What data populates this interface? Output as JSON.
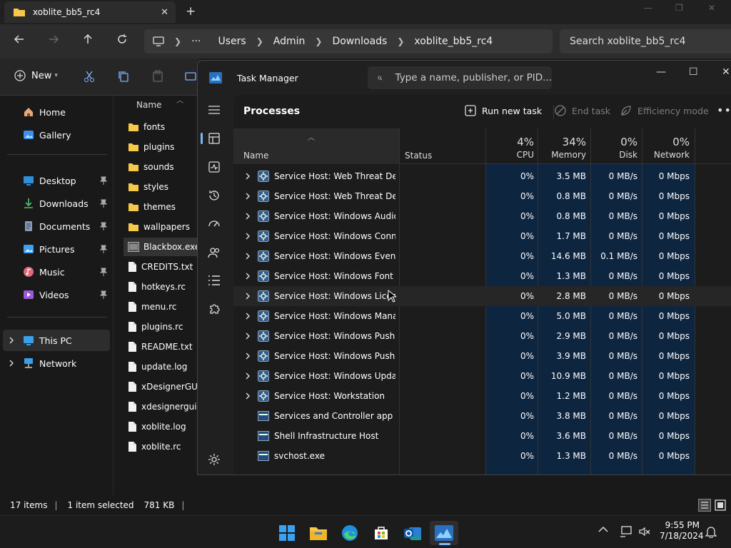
{
  "explorer": {
    "tab_title": "xoblite_bb5_rc4",
    "breadcrumb": [
      "Users",
      "Admin",
      "Downloads",
      "xoblite_bb5_rc4"
    ],
    "search_placeholder": "Search xoblite_bb5_rc4",
    "new_label": "New",
    "list_header": "Name",
    "nav_items": [
      {
        "label": "Home"
      },
      {
        "label": "Gallery"
      },
      {
        "label": "Desktop"
      },
      {
        "label": "Downloads"
      },
      {
        "label": "Documents"
      },
      {
        "label": "Pictures"
      },
      {
        "label": "Music"
      },
      {
        "label": "Videos"
      },
      {
        "label": "This PC"
      },
      {
        "label": "Network"
      }
    ],
    "files": [
      {
        "name": "fonts",
        "type": "folder"
      },
      {
        "name": "plugins",
        "type": "folder"
      },
      {
        "name": "sounds",
        "type": "folder"
      },
      {
        "name": "styles",
        "type": "folder"
      },
      {
        "name": "themes",
        "type": "folder"
      },
      {
        "name": "wallpapers",
        "type": "folder"
      },
      {
        "name": "Blackbox.exe",
        "type": "exe"
      },
      {
        "name": "CREDITS.txt",
        "type": "file"
      },
      {
        "name": "hotkeys.rc",
        "type": "file"
      },
      {
        "name": "menu.rc",
        "type": "file"
      },
      {
        "name": "plugins.rc",
        "type": "file"
      },
      {
        "name": "README.txt",
        "type": "file"
      },
      {
        "name": "update.log",
        "type": "file"
      },
      {
        "name": "xDesignerGUI.c",
        "type": "file"
      },
      {
        "name": "xdesignergui.rc",
        "type": "file"
      },
      {
        "name": "xoblite.log",
        "type": "file"
      },
      {
        "name": "xoblite.rc",
        "type": "file"
      }
    ],
    "status": {
      "items": "17 items",
      "selected": "1 item selected",
      "size": "781 KB"
    }
  },
  "taskmgr": {
    "title": "Task Manager",
    "search_placeholder": "Type a name, publisher, or PID...",
    "section_title": "Processes",
    "actions": {
      "run_new_task": "Run new task",
      "end_task": "End task",
      "efficiency_mode": "Efficiency mode"
    },
    "columns": {
      "name": "Name",
      "status": "Status",
      "cpu_pct": "4%",
      "cpu": "CPU",
      "mem_pct": "34%",
      "mem": "Memory",
      "disk_pct": "0%",
      "disk": "Disk",
      "net_pct": "0%",
      "net": "Network"
    },
    "processes": [
      {
        "name": "Service Host: Web Threat Defe...",
        "cpu": "0%",
        "mem": "3.5 MB",
        "disk": "0 MB/s",
        "net": "0 Mbps",
        "expand": true
      },
      {
        "name": "Service Host: Web Threat Defe...",
        "cpu": "0%",
        "mem": "0.8 MB",
        "disk": "0 MB/s",
        "net": "0 Mbps",
        "expand": true
      },
      {
        "name": "Service Host: Windows Audio ...",
        "cpu": "0%",
        "mem": "0.8 MB",
        "disk": "0 MB/s",
        "net": "0 Mbps",
        "expand": true
      },
      {
        "name": "Service Host: Windows Conne...",
        "cpu": "0%",
        "mem": "1.7 MB",
        "disk": "0 MB/s",
        "net": "0 Mbps",
        "expand": true
      },
      {
        "name": "Service Host: Windows Event ...",
        "cpu": "0%",
        "mem": "14.6 MB",
        "disk": "0.1 MB/s",
        "net": "0 Mbps",
        "expand": true
      },
      {
        "name": "Service Host: Windows Font C...",
        "cpu": "0%",
        "mem": "1.3 MB",
        "disk": "0 MB/s",
        "net": "0 Mbps",
        "expand": true
      },
      {
        "name": "Service Host: Windows License...",
        "cpu": "0%",
        "mem": "2.8 MB",
        "disk": "0 MB/s",
        "net": "0 Mbps",
        "expand": true
      },
      {
        "name": "Service Host: Windows Manag...",
        "cpu": "0%",
        "mem": "5.0 MB",
        "disk": "0 MB/s",
        "net": "0 Mbps",
        "expand": true
      },
      {
        "name": "Service Host: Windows Push ...",
        "cpu": "0%",
        "mem": "2.9 MB",
        "disk": "0 MB/s",
        "net": "0 Mbps",
        "expand": true
      },
      {
        "name": "Service Host: Windows Push ...",
        "cpu": "0%",
        "mem": "3.9 MB",
        "disk": "0 MB/s",
        "net": "0 Mbps",
        "expand": true
      },
      {
        "name": "Service Host: Windows Update",
        "cpu": "0%",
        "mem": "10.9 MB",
        "disk": "0 MB/s",
        "net": "0 Mbps",
        "expand": true
      },
      {
        "name": "Service Host: Workstation",
        "cpu": "0%",
        "mem": "1.2 MB",
        "disk": "0 MB/s",
        "net": "0 Mbps",
        "expand": true
      },
      {
        "name": "Services and Controller app",
        "cpu": "0%",
        "mem": "3.8 MB",
        "disk": "0 MB/s",
        "net": "0 Mbps",
        "expand": false
      },
      {
        "name": "Shell Infrastructure Host",
        "cpu": "0%",
        "mem": "3.6 MB",
        "disk": "0 MB/s",
        "net": "0 Mbps",
        "expand": false
      },
      {
        "name": "svchost.exe",
        "cpu": "0%",
        "mem": "1.3 MB",
        "disk": "0 MB/s",
        "net": "0 Mbps",
        "expand": false
      }
    ]
  },
  "taskbar": {
    "time": "9:55 PM",
    "date": "7/18/2024"
  },
  "colors": {
    "accent": "#7fb4ff",
    "heatmap": "#0e2540",
    "folder": "#f7c948"
  }
}
